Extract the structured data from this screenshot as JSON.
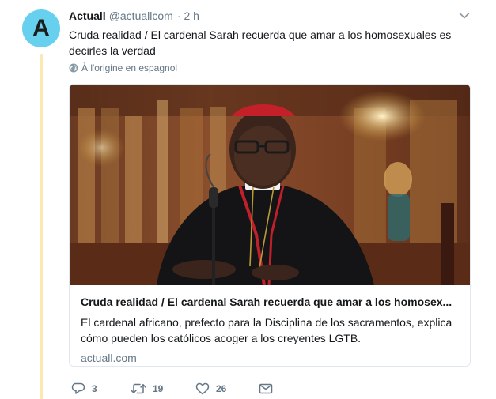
{
  "tweet": {
    "avatar_letter": "A",
    "name": "Actuall",
    "handle": "@actuallcom",
    "separator": "·",
    "time": "2 h",
    "text": "Cruda realidad / El cardenal Sarah recuerda que amar a los homosexuales es decirles la verdad",
    "translate_label": "À l'origine en espagnol"
  },
  "card": {
    "title": "Cruda realidad / El cardenal Sarah recuerda que amar a los homosex...",
    "description": "El cardenal africano, prefecto para la Disciplina de los sacramentos, explica cómo pueden los católicos acoger a los creyentes LGTB.",
    "domain": "actuall.com"
  },
  "actions": {
    "replies": "3",
    "retweets": "19",
    "likes": "26"
  },
  "colors": {
    "avatar_bg": "#66d0ee",
    "thread_line": "#fce8b2",
    "secondary_text": "#657786",
    "border": "#e1e8ed"
  },
  "icons": [
    "chevron-down-icon",
    "globe-icon",
    "reply-icon",
    "retweet-icon",
    "like-icon",
    "direct-message-icon"
  ]
}
